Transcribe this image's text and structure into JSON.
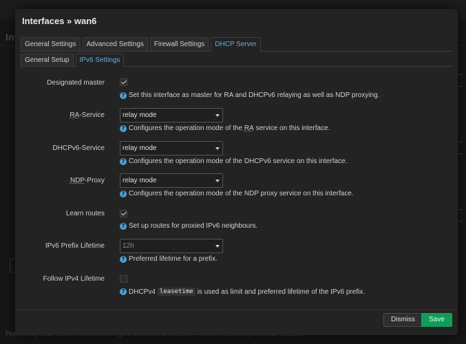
{
  "background": {
    "title": "Int",
    "topbar_text": "",
    "footer_text": "Powered by LuCI openwrt-23.05 branch (git-24.086.45142-09d5a38) / OpenWrt 23.05.3 (r23809-234f1a2efa)"
  },
  "modal": {
    "title": "Interfaces » wan6",
    "tabs": [
      {
        "label": "General Settings"
      },
      {
        "label": "Advanced Settings"
      },
      {
        "label": "Firewall Settings"
      },
      {
        "label": "DHCP Server"
      }
    ],
    "subtabs": [
      {
        "label": "General Setup"
      },
      {
        "label": "IPv6 Settings"
      }
    ],
    "fields": {
      "designated_master": {
        "label": "Designated master",
        "checked": true,
        "help": "Set this interface as master for RA and DHCPv6 relaying as well as NDP proxying."
      },
      "ra_service": {
        "label_abbr": "RA",
        "label_rest": "-Service",
        "value": "relay mode",
        "help_pre": "Configures the operation mode of the ",
        "help_abbr": "RA",
        "help_post": " service on this interface."
      },
      "dhcpv6_service": {
        "label": "DHCPv6-Service",
        "value": "relay mode",
        "help": "Configures the operation mode of the DHCPv6 service on this interface."
      },
      "ndp_proxy": {
        "label_abbr": "NDP",
        "label_rest": "-Proxy",
        "value": "relay mode",
        "help": "Configures the operation mode of the NDP proxy service on this interface."
      },
      "learn_routes": {
        "label": "Learn routes",
        "checked": true,
        "help": "Set up routes for proxied IPv6 neighbours."
      },
      "ipv6_prefix_lifetime": {
        "label": "IPv6 Prefix Lifetime",
        "value": "12h",
        "help": "Preferred lifetime for a prefix."
      },
      "follow_ipv4_lifetime": {
        "label": "Follow IPv4 Lifetime",
        "checked": false,
        "help_pre": "DHCPv4",
        "help_code": "leasetime",
        "help_post": "is used as limit and preferred lifetime of the IPv6 prefix."
      }
    },
    "buttons": {
      "dismiss": "Dismiss",
      "save": "Save"
    }
  },
  "colors": {
    "accent": "#5fb2df",
    "help_icon": "#4aa3d6",
    "save_button": "#0f9d58"
  },
  "icons": {
    "help": "question-circle-icon",
    "checkbox_check": "checkmark-icon",
    "select_caret": "caret-down-icon"
  }
}
